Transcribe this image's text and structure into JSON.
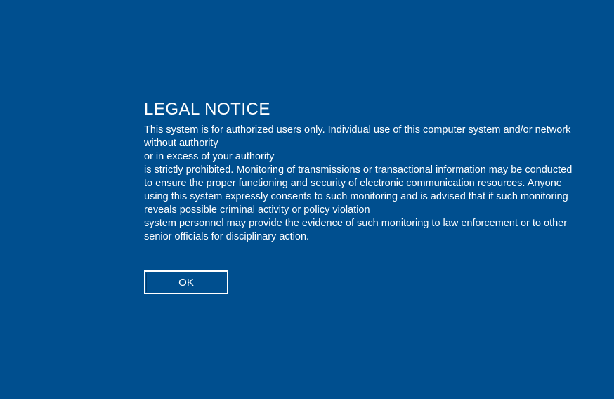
{
  "notice": {
    "title": "LEGAL NOTICE",
    "line1": "This system is for authorized users only. Individual use of this computer system and/or network without authority",
    "line2": " or in excess of your authority",
    "line3": " is strictly prohibited. Monitoring of transmissions or transactional information may be conducted to ensure the proper functioning and security of electronic communication resources. Anyone using this system expressly consents to such monitoring and is advised that if such monitoring reveals possible criminal activity or policy violation",
    "line4": " system personnel may provide the evidence of such monitoring to law enforcement or to other senior officials for disciplinary action."
  },
  "buttons": {
    "ok_label": "OK"
  }
}
